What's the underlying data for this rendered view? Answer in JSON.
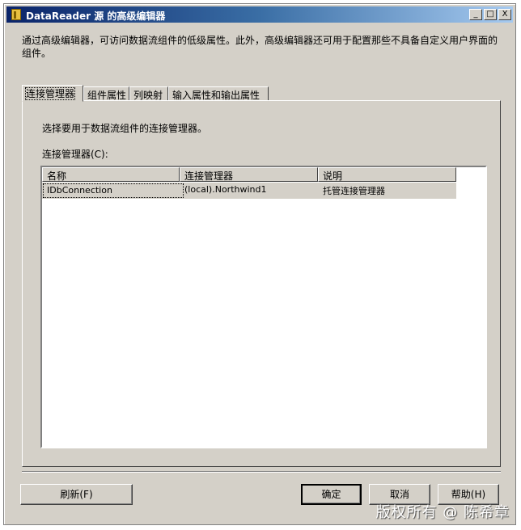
{
  "window": {
    "title": "DataReader 源 的高级编辑器",
    "description": "通过高级编辑器，可访问数据流组件的低级属性。此外，高级编辑器还可用于配置那些不具备自定义用户界面的组件。",
    "controls": {
      "minimize": "_",
      "maximize": "□",
      "close": "X"
    }
  },
  "tabs": [
    {
      "label": "连接管理器",
      "active": true
    },
    {
      "label": "组件属性",
      "active": false
    },
    {
      "label": "列映射",
      "active": false
    },
    {
      "label": "输入属性和输出属性",
      "active": false
    }
  ],
  "panel": {
    "intro": "选择要用于数据流组件的连接管理器。",
    "list_label": "连接管理器(C):",
    "columns": [
      "名称",
      "连接管理器",
      "说明"
    ],
    "rows": [
      [
        "IDbConnection",
        "(local).Northwind1",
        "托管连接管理器"
      ]
    ]
  },
  "buttons": {
    "refresh": "刷新(F)",
    "ok": "确定",
    "cancel": "取消",
    "help": "帮助(H)"
  },
  "watermark": "版权所有 @ 陈希章"
}
